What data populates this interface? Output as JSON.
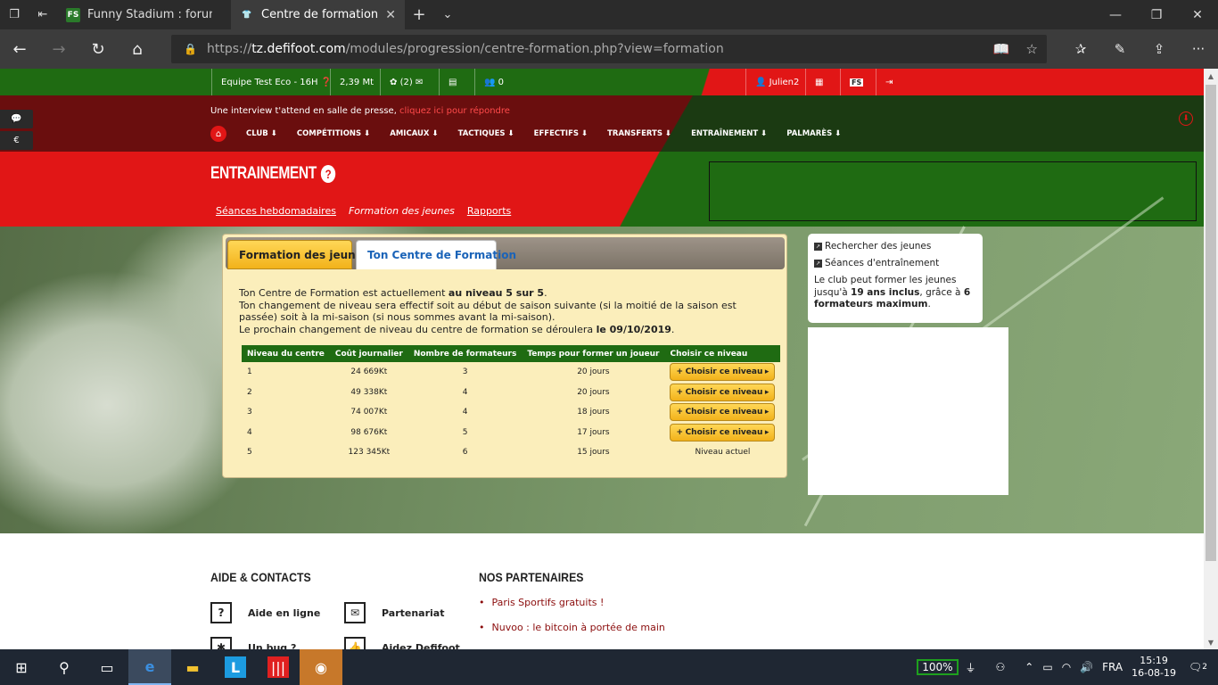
{
  "browser": {
    "tabs": [
      {
        "title": "Funny Stadium : forum parti",
        "fav": "FS"
      },
      {
        "title": "Centre de formation",
        "fav": "👕"
      }
    ],
    "url_host": "tz.defifoot.com",
    "url_path": "/modules/progression/centre-formation.php?view=formation",
    "url_prefix": "https://"
  },
  "topstrip": {
    "team": "Equipe Test Eco - 16H",
    "money": "2,39 Mt",
    "messages": "(2)",
    "friends": "0",
    "user": "Julien2",
    "fs": "FS"
  },
  "notice": {
    "text": "Une interview t'attend en salle de presse, ",
    "link": "cliquez ici pour répondre"
  },
  "menu": [
    "CLUB",
    "COMPÉTITIONS",
    "AMICAUX",
    "TACTIQUES",
    "EFFECTIFS",
    "TRANSFERTS",
    "ENTRAÎNEMENT",
    "PALMARÈS"
  ],
  "sidebtns": [
    "💬",
    "€",
    "👤"
  ],
  "page": {
    "title": "ENTRAINEMENT",
    "qmark": "?",
    "subnav": [
      "Séances hebdomadaires",
      "Formation des jeunes",
      "Rapports"
    ]
  },
  "panel": {
    "tab1": "Formation des jeunes",
    "tab2": "Ton Centre de Formation",
    "line1_pre": "Ton Centre de Formation est actuellement ",
    "line1_bold": "au niveau 5 sur 5",
    "line1_post": ".",
    "line2": "Ton changement de niveau sera effectif soit au début de saison suivante (si la moitié de la saison est passée) soit à la mi-saison (si nous sommes avant la mi-saison).",
    "line3_pre": "Le prochain changement de niveau du centre de formation se déroulera ",
    "line3_bold": "le 09/10/2019",
    "line3_post": ".",
    "headers": [
      "Niveau du centre",
      "Coût journalier",
      "Nombre de formateurs",
      "Temps pour former un joueur",
      "Choisir ce niveau"
    ],
    "rows": [
      {
        "level": "1",
        "cost": "24 669Kt",
        "trainers": "3",
        "time": "20 jours",
        "action": "Choisir ce niveau"
      },
      {
        "level": "2",
        "cost": "49 338Kt",
        "trainers": "4",
        "time": "20 jours",
        "action": "Choisir ce niveau"
      },
      {
        "level": "3",
        "cost": "74 007Kt",
        "trainers": "4",
        "time": "18 jours",
        "action": "Choisir ce niveau"
      },
      {
        "level": "4",
        "cost": "98 676Kt",
        "trainers": "5",
        "time": "17 jours",
        "action": "Choisir ce niveau"
      },
      {
        "level": "5",
        "cost": "123 345Kt",
        "trainers": "6",
        "time": "15 jours",
        "action": "Niveau actuel"
      }
    ]
  },
  "rbox": {
    "link1": "Rechercher des jeunes",
    "link2": "Séances d'entraînement",
    "p_pre": "Le club peut former les jeunes jusqu'à ",
    "p_b1": "19 ans inclus",
    "p_mid": ", grâce à ",
    "p_b2": "6 formateurs maximum",
    "p_post": "."
  },
  "footer": {
    "help_title": "AIDE & CONTACTS",
    "partners_title": "NOS PARTENAIRES",
    "help_online": "Aide en ligne",
    "partnership": "Partenariat",
    "bug": "Un bug ?",
    "help_defifoot": "Aidez Defifoot",
    "partners": [
      "Paris Sportifs gratuits !",
      "Nuvoo : le bitcoin à portée de main"
    ]
  },
  "taskbar": {
    "battery": "100%",
    "lang": "FRA",
    "time": "15:19",
    "date": "16-08-19",
    "notif": "2"
  }
}
